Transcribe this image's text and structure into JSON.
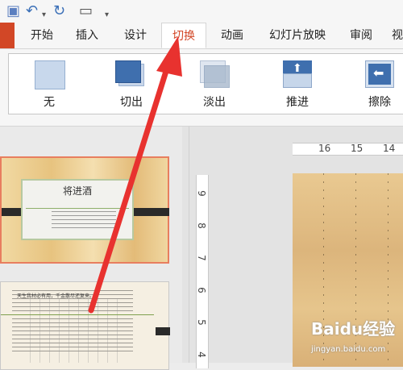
{
  "ribbon": {
    "tabs": [
      {
        "label": "开始",
        "active": false
      },
      {
        "label": "插入",
        "active": false
      },
      {
        "label": "设计",
        "active": false
      },
      {
        "label": "切换",
        "active": true
      },
      {
        "label": "动画",
        "active": false
      },
      {
        "label": "幻灯片放映",
        "active": false
      },
      {
        "label": "审阅",
        "active": false
      },
      {
        "label": "视",
        "active": false
      }
    ],
    "transitions": [
      {
        "label": "无",
        "icon": "none-transition-icon"
      },
      {
        "label": "切出",
        "icon": "cut-transition-icon"
      },
      {
        "label": "淡出",
        "icon": "fade-transition-icon"
      },
      {
        "label": "推进",
        "icon": "push-transition-icon"
      },
      {
        "label": "擦除",
        "icon": "wipe-transition-icon"
      }
    ]
  },
  "slides": {
    "slide1_title": "将进酒",
    "slide2_text": "天生我材必有用，千金散尽还复来。"
  },
  "rulers": {
    "horizontal": [
      "16",
      "15",
      "14"
    ],
    "vertical": [
      "9",
      "8",
      "7",
      "6",
      "5",
      "4"
    ]
  },
  "watermark": {
    "main": "Baidu经验",
    "sub": "jingyan.baidu.com"
  },
  "colors": {
    "accent": "#d24726",
    "arrow": "#e8322f"
  }
}
